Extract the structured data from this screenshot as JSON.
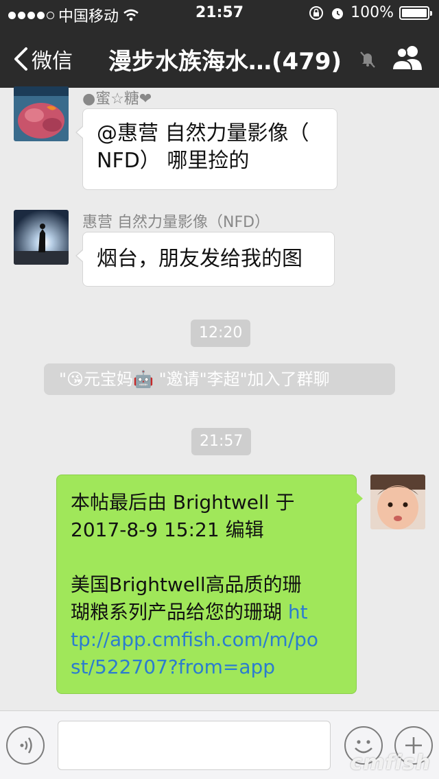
{
  "status_bar": {
    "carrier": "中国移动",
    "time": "21:57",
    "battery_text": "100%"
  },
  "nav": {
    "back_label": "微信",
    "title": "漫步水族海水…(479)"
  },
  "messages": [
    {
      "sender": "●蜜☆糖❤",
      "text_lines": [
        "@惠营 自然力量影像（",
        "NFD） 哪里捡的"
      ]
    },
    {
      "sender": "惠营 自然力量影像（NFD）",
      "text_lines": [
        "烟台，朋友发给我的图"
      ]
    }
  ],
  "timestamps": [
    "12:20",
    "21:57"
  ],
  "system_message": "\"😘元宝妈🤖 \"邀请\"李超\"加入了群聊",
  "own_message": {
    "line1": "本帖最后由 Brightwell 于",
    "line2": "2017-8-9 15:21 编辑",
    "line3": "美国Brightwell高品质的珊",
    "line4": "瑚粮系列产品给您的珊瑚 ",
    "link_part1": "ht",
    "link_part2": "tp://app.cmfish.com/m/po",
    "link_part3": "st/522707?from=app"
  },
  "watermark": "cmfish",
  "colors": {
    "bar_bg": "#2b2b2b",
    "chat_bg": "#ebebeb",
    "own_bubble": "#a0e75a",
    "link": "#2b7ccf"
  }
}
